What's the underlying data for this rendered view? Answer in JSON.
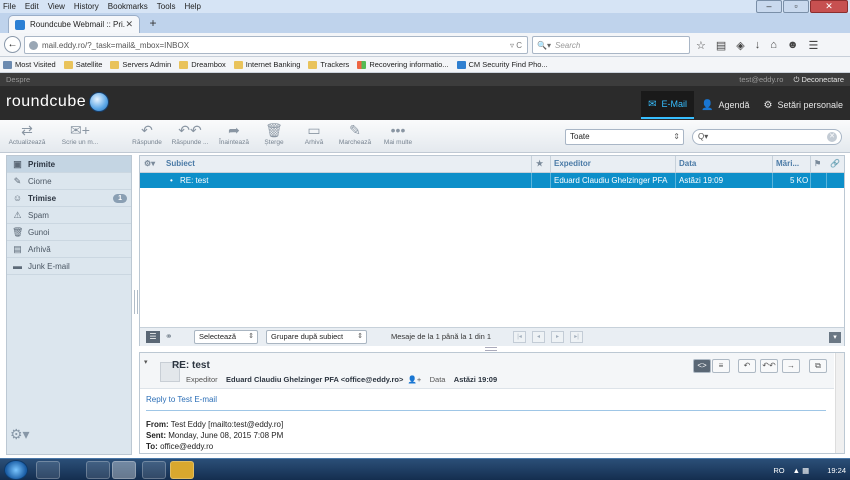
{
  "browser": {
    "menu": [
      "File",
      "Edit",
      "View",
      "History",
      "Bookmarks",
      "Tools",
      "Help"
    ],
    "tab_title": "Roundcube Webmail :: Pri...",
    "url": "mail.eddy.ro/?_task=mail&_mbox=INBOX",
    "search_placeholder": "Search",
    "bookmarks": [
      "Most Visited",
      "Satellite",
      "Servers Admin",
      "Dreambox",
      "Internet Banking",
      "Trackers",
      "Recovering informatio...",
      "CM Security Find Pho..."
    ]
  },
  "app": {
    "about": "Despre",
    "user_email": "test@eddy.ro",
    "logout": "Deconectare",
    "logo": "roundcube",
    "nav": {
      "email": "E-Mail",
      "contacts": "Agendă",
      "settings": "Setări personale"
    }
  },
  "toolbar": {
    "refresh": "Actualizează",
    "compose": "Scrie un m...",
    "reply": "Răspunde",
    "reply_all": "Răspunde ...",
    "forward": "Înaintează",
    "delete": "Șterge",
    "archive": "Arhivă",
    "mark": "Marchează",
    "more": "Mai multe",
    "filter": "Toate",
    "search_value": "Q▾"
  },
  "folders": [
    {
      "label": "Primite",
      "icon": "inbox-icon",
      "glyph": "▣",
      "bold": true,
      "selected": true,
      "badge": ""
    },
    {
      "label": "Ciorne",
      "icon": "drafts-icon",
      "glyph": "✎",
      "bold": false,
      "selected": false,
      "badge": ""
    },
    {
      "label": "Trimise",
      "icon": "sent-icon",
      "glyph": "☺",
      "bold": true,
      "selected": false,
      "badge": "1"
    },
    {
      "label": "Spam",
      "icon": "spam-icon",
      "glyph": "⚠",
      "bold": false,
      "selected": false,
      "badge": ""
    },
    {
      "label": "Gunoi",
      "icon": "trash-icon",
      "glyph": "🗑",
      "bold": false,
      "selected": false,
      "badge": ""
    },
    {
      "label": "Arhivă",
      "icon": "archive-icon",
      "glyph": "▤",
      "bold": false,
      "selected": false,
      "badge": ""
    },
    {
      "label": "Junk E-mail",
      "icon": "folder-icon",
      "glyph": "▬",
      "bold": false,
      "selected": false,
      "badge": ""
    }
  ],
  "list": {
    "headers": {
      "subject": "Subiect",
      "from": "Expeditor",
      "date": "Data",
      "size": "Mări..."
    },
    "row": {
      "subject": "RE: test",
      "from": "Eduard Claudiu Ghelzinger PFA",
      "date": "Astăzi 19:09",
      "size": "5 KO"
    },
    "footer": {
      "select": "Selectează",
      "group": "Grupare după subiect",
      "count": "Mesaje de la 1 până la 1 din 1"
    }
  },
  "preview": {
    "subject": "RE: test",
    "from_label": "Expeditor",
    "from": "Eduard Claudiu Ghelzinger PFA <office@eddy.ro>",
    "date_label": "Data",
    "date": "Astăzi 19:09",
    "reply_link": "Reply to Test E-mail",
    "lines": [
      {
        "k": "From:",
        "v": " Test Eddy [mailto:test@eddy.ro]"
      },
      {
        "k": "Sent:",
        "v": " Monday, June 08, 2015 7:08 PM"
      },
      {
        "k": "To:",
        "v": " office@eddy.ro"
      }
    ]
  },
  "taskbar": {
    "lang": "RO",
    "time": "19:24"
  }
}
